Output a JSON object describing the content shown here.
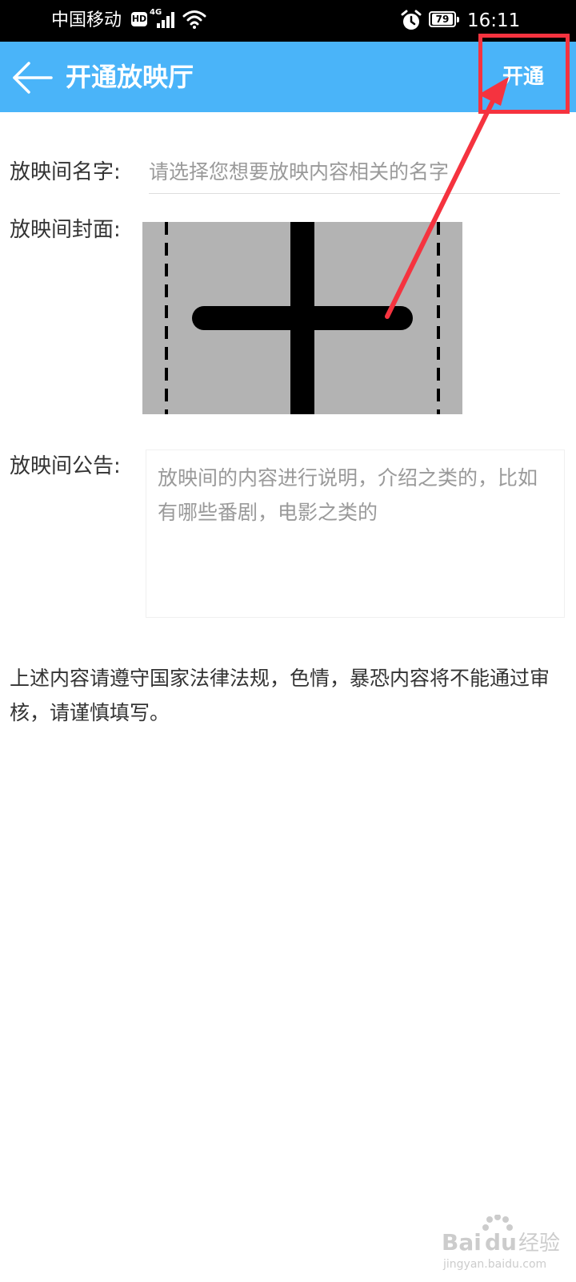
{
  "status_bar": {
    "carrier": "中国移动",
    "hd_badge": "HD",
    "network_type": "4G",
    "battery_level": "79",
    "time": "16:11"
  },
  "title_bar": {
    "title": "开通放映厅",
    "action_label": "开通",
    "background_color": "#4ab4f9"
  },
  "form": {
    "name_label": "放映间名字:",
    "name_placeholder": "请选择您想要放映内容相关的名字",
    "cover_label": "放映间封面:",
    "notice_label": "放映间公告:",
    "notice_placeholder": "放映间的内容进行说明，介绍之类的，比如有哪些番剧，电影之类的"
  },
  "disclaimer": "上述内容请遵守国家法律法规，色情，暴恐内容将不能通过审核，请谨慎填写。",
  "annotation": {
    "color": "#f5333f"
  },
  "watermark": {
    "logo_text": "Baidu经验",
    "url": "jingyan.baidu.com"
  }
}
